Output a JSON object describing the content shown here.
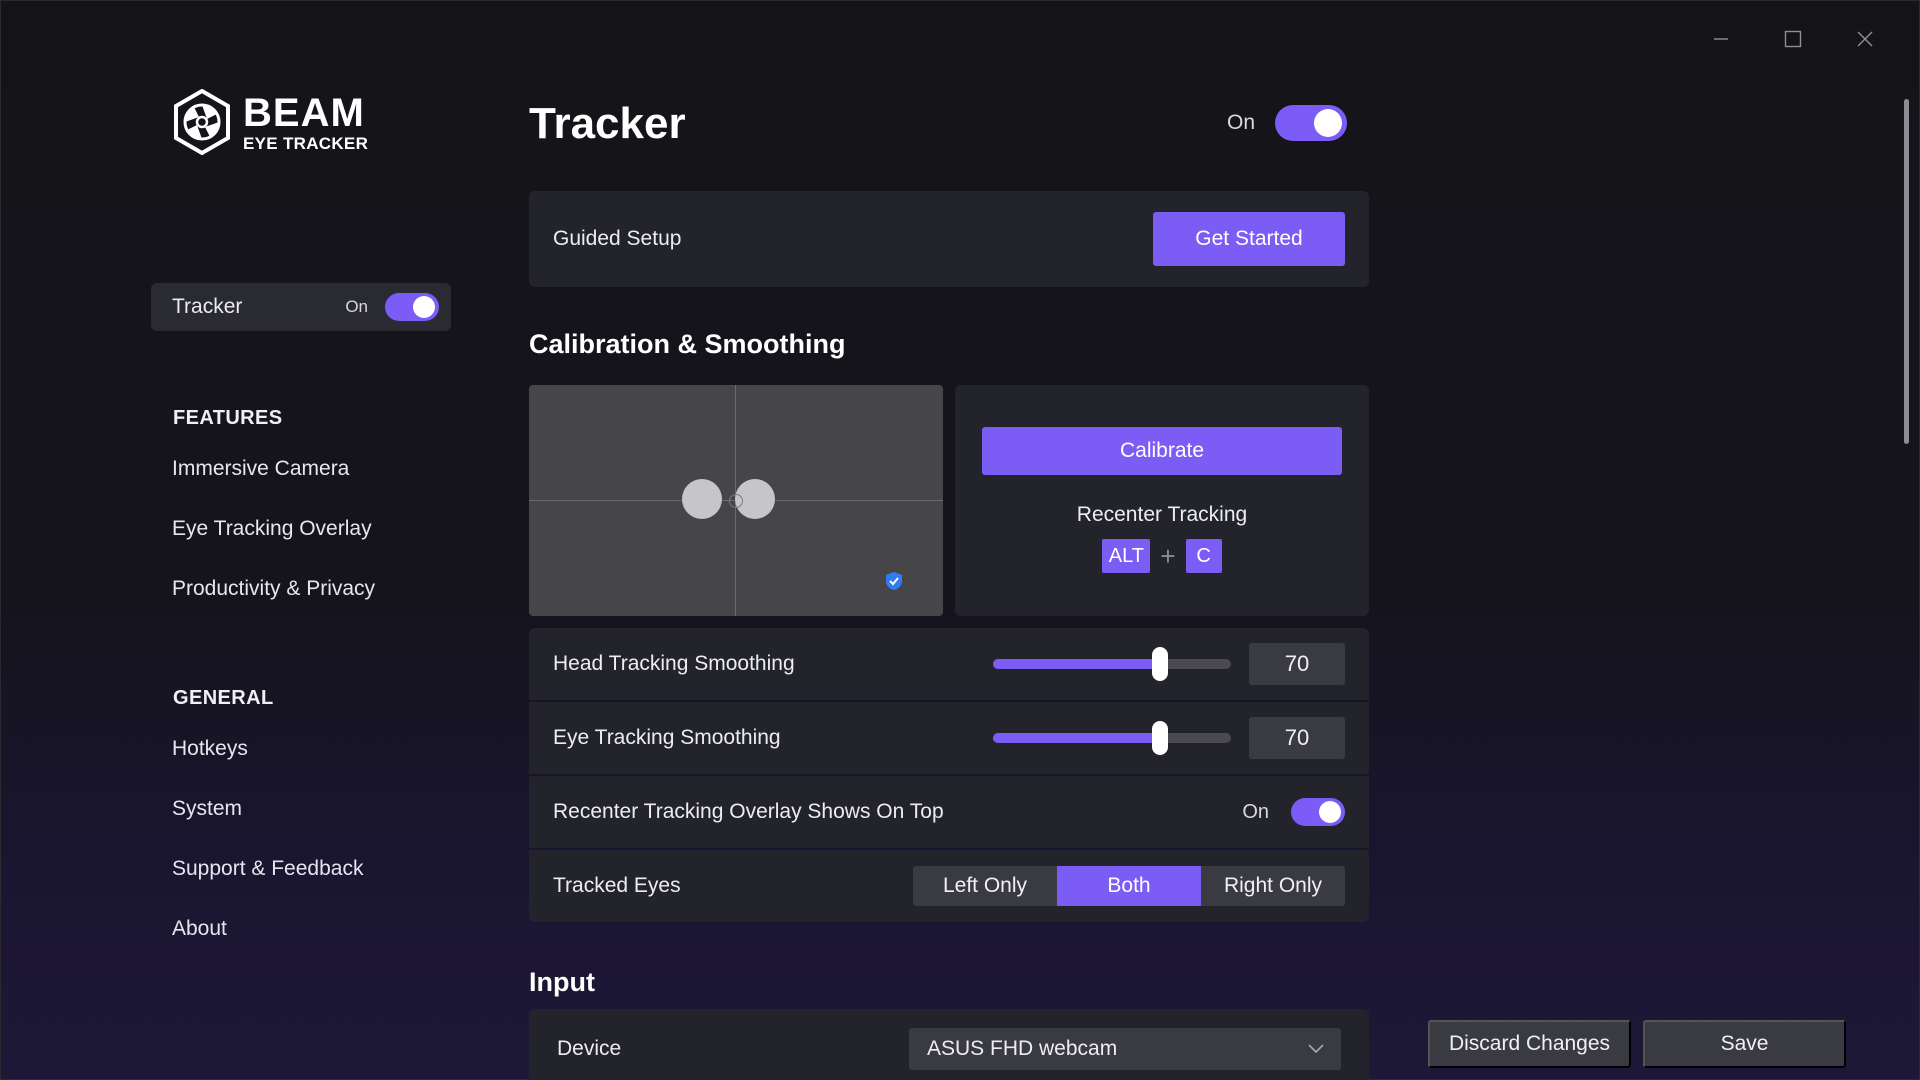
{
  "app": {
    "logo_name": "BEAM",
    "logo_sub": "EYE TRACKER"
  },
  "sidebar": {
    "tracker": {
      "label": "Tracker",
      "state": "On"
    },
    "features_heading": "FEATURES",
    "features": [
      {
        "label": "Immersive Camera"
      },
      {
        "label": "Eye Tracking Overlay"
      },
      {
        "label": "Productivity & Privacy"
      }
    ],
    "general_heading": "GENERAL",
    "general": [
      {
        "label": "Hotkeys"
      },
      {
        "label": "System"
      },
      {
        "label": "Support & Feedback"
      },
      {
        "label": "About"
      }
    ]
  },
  "page": {
    "title": "Tracker",
    "toggle_state": "On"
  },
  "guided_setup": {
    "label": "Guided Setup",
    "button": "Get Started"
  },
  "calibration": {
    "heading": "Calibration & Smoothing",
    "calibrate_button": "Calibrate",
    "recenter_label": "Recenter Tracking",
    "hotkey_mod": "ALT",
    "hotkey_plus": "+",
    "hotkey_key": "C"
  },
  "settings": {
    "head_smoothing": {
      "label": "Head Tracking Smoothing",
      "value": "70",
      "fraction": 0.7
    },
    "eye_smoothing": {
      "label": "Eye Tracking Smoothing",
      "value": "70",
      "fraction": 0.7
    },
    "overlay_on_top": {
      "label": "Recenter Tracking Overlay Shows On Top",
      "state": "On"
    },
    "tracked_eyes": {
      "label": "Tracked Eyes",
      "options": [
        "Left Only",
        "Both",
        "Right Only"
      ],
      "selected": "Both"
    }
  },
  "input": {
    "heading": "Input",
    "device_label": "Device",
    "device_value": "ASUS FHD webcam"
  },
  "footer": {
    "discard": "Discard Changes",
    "save": "Save"
  },
  "colors": {
    "accent": "#7b5df6",
    "card": "#23232b",
    "control": "#3a3a42"
  }
}
